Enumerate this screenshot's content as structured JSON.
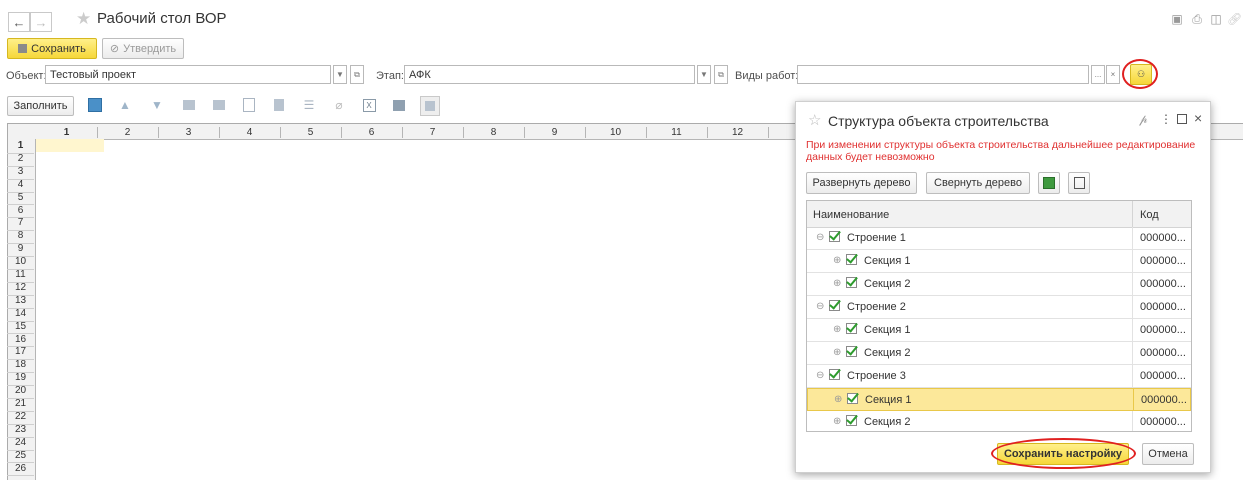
{
  "window": {
    "title": "Рабочий стол ВОР"
  },
  "toolbar": {
    "save_label": "Сохранить",
    "approve_label": "Утвердить"
  },
  "filters": {
    "object_label": "Объект:",
    "object_value": "Тестовый проект",
    "stage_label": "Этап:",
    "stage_value": "АФК",
    "work_types_label": "Виды работ:",
    "work_types_value": ""
  },
  "sheet_toolbar": {
    "fill_label": "Заполнить"
  },
  "sheet": {
    "columns": [
      "1",
      "2",
      "3",
      "4",
      "5",
      "6",
      "7",
      "8",
      "9",
      "10",
      "11",
      "12"
    ],
    "rows": [
      "1",
      "2",
      "3",
      "4",
      "5",
      "6",
      "7",
      "8",
      "9",
      "10",
      "11",
      "12",
      "13",
      "14",
      "15",
      "16",
      "17",
      "18",
      "19",
      "20",
      "21",
      "22",
      "23",
      "24",
      "25",
      "26"
    ]
  },
  "dialog": {
    "title": "Структура объекта строительства",
    "warning": "При изменении структуры объекта строительства дальнейшее редактирование данных будет невозможно",
    "expand_label": "Развернуть дерево",
    "collapse_label": "Свернуть дерево",
    "col_name": "Наименование",
    "col_code": "Код",
    "rows": [
      {
        "name": "Строение 1",
        "code": "000000..."
      },
      {
        "name": "Секция 1",
        "code": "000000..."
      },
      {
        "name": "Секция 2",
        "code": "000000..."
      },
      {
        "name": "Строение 2",
        "code": "000000..."
      },
      {
        "name": "Секция 1",
        "code": "000000..."
      },
      {
        "name": "Секция 2",
        "code": "000000..."
      },
      {
        "name": "Строение 3",
        "code": "000000..."
      },
      {
        "name": "Секция 1",
        "code": "000000..."
      },
      {
        "name": "Секция 2",
        "code": "000000..."
      }
    ],
    "save_settings_label": "Сохранить настройку",
    "cancel_label": "Отмена"
  },
  "colors": {
    "accent_yellow": "#f6d73a",
    "warning_red": "#e03030",
    "selected_row": "#fce89a",
    "highlight_circle": "#e02020"
  }
}
